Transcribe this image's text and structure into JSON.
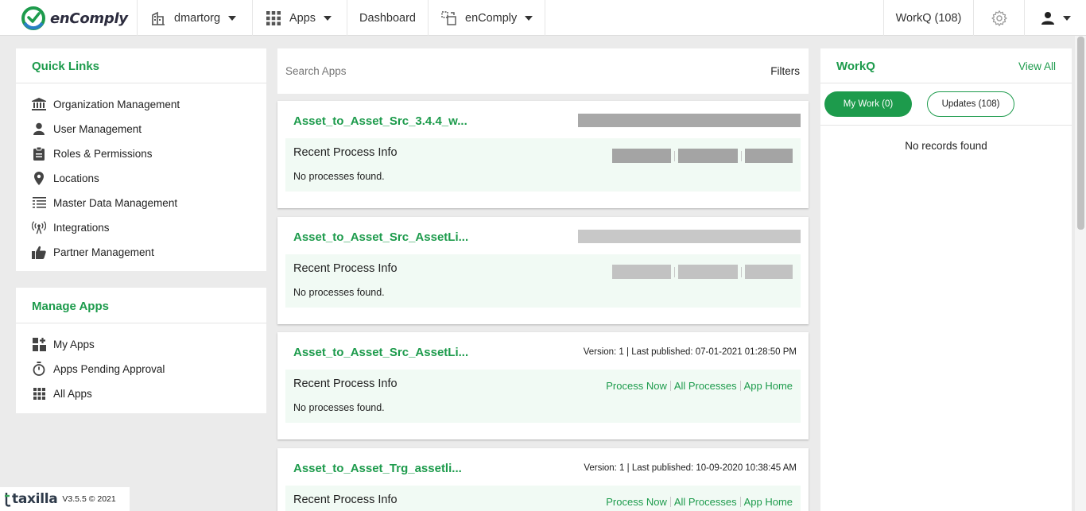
{
  "nav": {
    "brand": "enComply",
    "org": "dmartorg",
    "apps": "Apps",
    "dashboard": "Dashboard",
    "product": "enComply",
    "workq": "WorkQ (108)"
  },
  "quick_links": {
    "title": "Quick Links",
    "items": [
      {
        "label": "Organization Management",
        "icon": "bank-icon"
      },
      {
        "label": "User Management",
        "icon": "user-icon"
      },
      {
        "label": "Roles & Permissions",
        "icon": "clipboard-icon"
      },
      {
        "label": "Locations",
        "icon": "map-pin-icon"
      },
      {
        "label": "Master Data Management",
        "icon": "list-icon"
      },
      {
        "label": "Integrations",
        "icon": "broadcast-icon"
      },
      {
        "label": "Partner Management",
        "icon": "thumbs-up-icon"
      }
    ]
  },
  "manage_apps": {
    "title": "Manage Apps",
    "items": [
      {
        "label": "My Apps",
        "icon": "apps-plus-icon"
      },
      {
        "label": "Apps Pending Approval",
        "icon": "stopwatch-icon"
      },
      {
        "label": "All Apps",
        "icon": "grid-icon"
      }
    ]
  },
  "search": {
    "placeholder": "Search Apps",
    "filters": "Filters"
  },
  "cards": [
    {
      "title": "Asset_to_Asset_Src_3.4.4_w...",
      "meta": "",
      "section": "Recent Process Info",
      "status": "No processes found."
    },
    {
      "title": "Asset_to_Asset_Src_AssetLi...",
      "meta": "",
      "section": "Recent Process Info",
      "status": "No processes found."
    },
    {
      "title": "Asset_to_Asset_Src_AssetLi...",
      "meta": "Version: 1 | Last published: 07-01-2021 01:28:50 PM",
      "section": "Recent Process Info",
      "status": "No processes found.",
      "actions": [
        "Process Now",
        "All Processes",
        "App Home"
      ]
    },
    {
      "title": "Asset_to_Asset_Trg_assetli...",
      "meta": "Version: 1 | Last published: 10-09-2020 10:38:45 AM",
      "section": "Recent Process Info",
      "status": "",
      "actions": [
        "Process Now",
        "All Processes",
        "App Home"
      ]
    }
  ],
  "workq": {
    "title": "WorkQ",
    "view_all": "View All",
    "my_work": "My Work (0)",
    "updates": "Updates (108)",
    "empty": "No records found"
  },
  "footer": {
    "brand": "taxilla",
    "version": "V3.5.5 © 2021"
  },
  "colors": {
    "accent": "#1d9b4c",
    "card_inner": "#f1faf4",
    "background": "#ebebeb"
  }
}
